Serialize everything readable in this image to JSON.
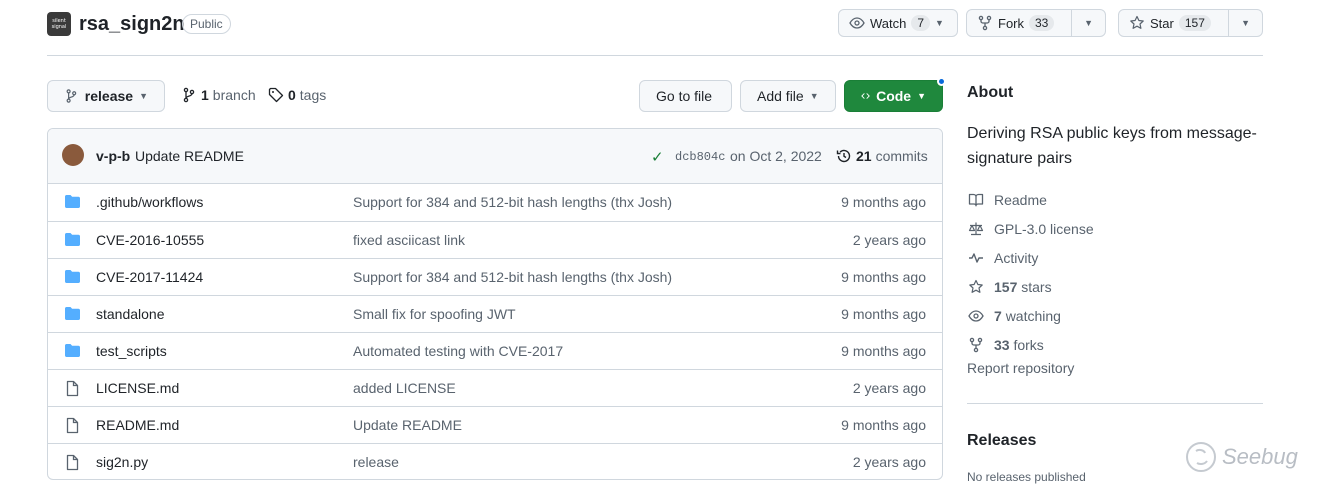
{
  "repo": {
    "avatar_text": "silent signal",
    "name": "rsa_sign2n",
    "visibility": "Public"
  },
  "actions": {
    "watch_label": "Watch",
    "watch_count": "7",
    "fork_label": "Fork",
    "fork_count": "33",
    "star_label": "Star",
    "star_count": "157"
  },
  "toolbar": {
    "branch": "release",
    "branches_count": "1",
    "branches_label": "branch",
    "tags_count": "0",
    "tags_label": "tags",
    "go_to_file": "Go to file",
    "add_file": "Add file",
    "code": "Code"
  },
  "latest_commit": {
    "author": "v-p-b",
    "message": "Update README",
    "hash": "dcb804c",
    "date": "on Oct 2, 2022",
    "count": "21",
    "count_label": "commits"
  },
  "files": [
    {
      "type": "dir",
      "name": ".github/workflows",
      "message": "Support for 384 and 512-bit hash lengths (thx Josh)",
      "age": "9 months ago"
    },
    {
      "type": "dir",
      "name": "CVE-2016-10555",
      "message": "fixed asciicast link",
      "age": "2 years ago"
    },
    {
      "type": "dir",
      "name": "CVE-2017-11424",
      "message": "Support for 384 and 512-bit hash lengths (thx Josh)",
      "age": "9 months ago"
    },
    {
      "type": "dir",
      "name": "standalone",
      "message": "Small fix for spoofing JWT",
      "age": "9 months ago"
    },
    {
      "type": "dir",
      "name": "test_scripts",
      "message": "Automated testing with CVE-2017",
      "age": "9 months ago"
    },
    {
      "type": "file",
      "name": "LICENSE.md",
      "message": "added LICENSE",
      "age": "2 years ago"
    },
    {
      "type": "file",
      "name": "README.md",
      "message": "Update README",
      "age": "9 months ago"
    },
    {
      "type": "file",
      "name": "sig2n.py",
      "message": "release",
      "age": "2 years ago"
    }
  ],
  "about": {
    "title": "About",
    "description": "Deriving RSA public keys from message-signature pairs",
    "items": [
      {
        "icon": "book-icon",
        "bold": "",
        "text": "Readme"
      },
      {
        "icon": "law-icon",
        "bold": "",
        "text": "GPL-3.0 license"
      },
      {
        "icon": "pulse-icon",
        "bold": "",
        "text": "Activity"
      },
      {
        "icon": "star-icon",
        "bold": "157",
        "text": "stars"
      },
      {
        "icon": "eye-icon",
        "bold": "7",
        "text": "watching"
      },
      {
        "icon": "fork-icon",
        "bold": "33",
        "text": "forks"
      }
    ],
    "report": "Report repository"
  },
  "releases": {
    "title": "Releases",
    "empty": "No releases published"
  },
  "watermark": "Seebug",
  "colors": {
    "folder": "#54aeff",
    "code_button": "#1f883d",
    "check": "#1a7f37"
  }
}
